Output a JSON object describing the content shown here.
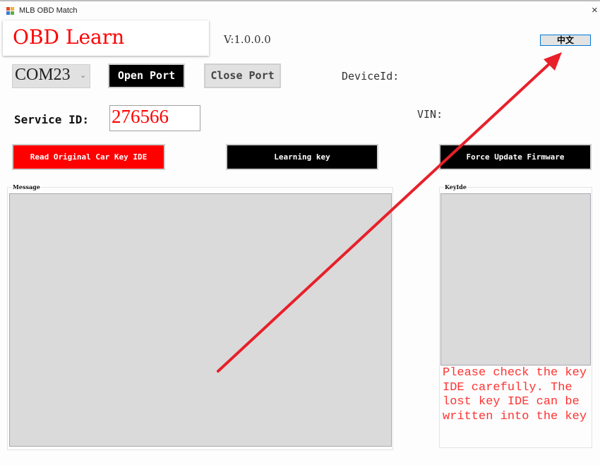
{
  "window": {
    "title": "MLB OBD Match",
    "close_glyph": "×",
    "icon": "app-window-icon"
  },
  "header": {
    "brand": "OBD Learn",
    "version": "V:1.0.0.0",
    "language_button": "中文"
  },
  "port": {
    "selected": "COM23",
    "chevron": "⌄",
    "open_label": "Open Port",
    "close_label": "Close Port"
  },
  "device": {
    "device_id_label": "DeviceId:",
    "vin_label": "VIN:"
  },
  "service": {
    "label": "Service ID:",
    "value": "276566"
  },
  "actions": {
    "read_label": "Read Original Car Key IDE",
    "learn_label": "Learning key",
    "force_label": "Force Update Firmware"
  },
  "message": {
    "legend": "Message",
    "content": ""
  },
  "keyide": {
    "legend": "KeyIde",
    "content": "",
    "note": "Please check the key IDE carefully. The lost key IDE can be written into the key"
  },
  "annotation": {
    "type": "arrow",
    "color": "#e8202a",
    "points_to": "language-button"
  },
  "colors": {
    "accent_red": "#ff0000",
    "button_black": "#000000",
    "focus_blue": "#0078d7",
    "panel_gray": "#dadada"
  }
}
